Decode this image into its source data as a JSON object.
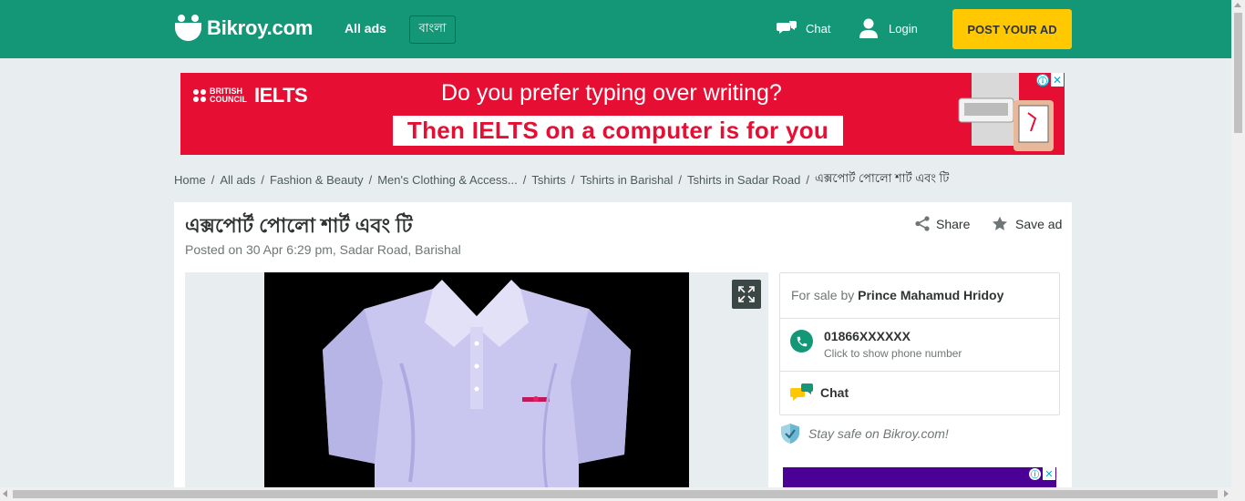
{
  "header": {
    "logo_text": "Bikroy.com",
    "all_ads": "All ads",
    "language": "বাংলা",
    "chat": "Chat",
    "login": "Login",
    "post_ad": "POST YOUR AD",
    "brand_color": "#149777",
    "post_color": "#ffc800"
  },
  "banner_ad": {
    "brand_small": "BRITISH\nCOUNCIL",
    "brand_name": "IELTS",
    "headline": "Do you prefer typing over writing?",
    "subline": "Then IELTS on a computer is for you",
    "info_icon": "ⓘ",
    "close_icon": "✕",
    "bg_color": "#e60f33"
  },
  "breadcrumb": [
    "Home",
    "All ads",
    "Fashion & Beauty",
    "Men's Clothing & Access...",
    "Tshirts",
    "Tshirts in Barishal",
    "Tshirts in Sadar Road",
    "এক্সপোর্ট পোলো শার্ট এবং টি"
  ],
  "listing": {
    "title": "এক্সপোর্ট পোলো শার্ট এবং টি",
    "posted": "Posted on 30 Apr 6:29 pm, Sadar Road, Barishal",
    "share": "Share",
    "save": "Save ad"
  },
  "seller": {
    "for_sale_prefix": "For sale by",
    "name": "Prince Mahamud Hridoy",
    "phone": "01866XXXXXX",
    "phone_hint": "Click to show phone number",
    "chat": "Chat",
    "stay_safe": "Stay safe on Bikroy.com!"
  },
  "side_ad": {
    "info_icon": "ⓘ",
    "close_icon": "✕",
    "bg_color": "#4b0096"
  }
}
